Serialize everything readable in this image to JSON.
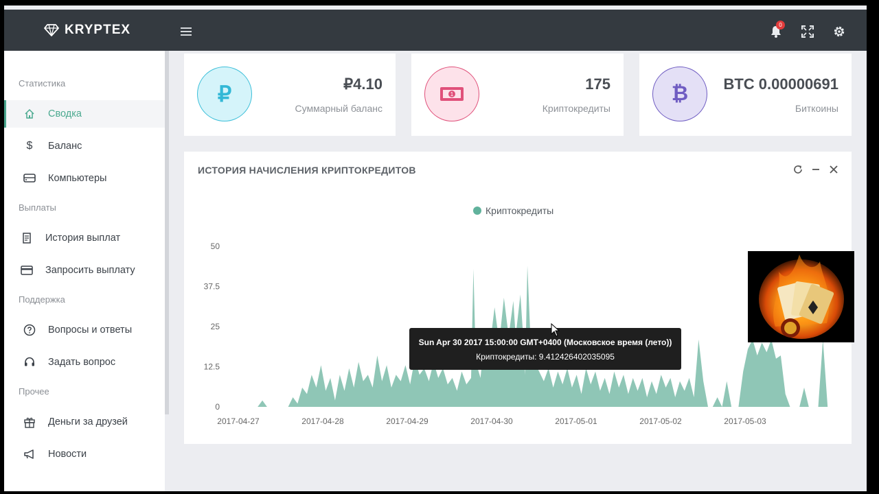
{
  "app": {
    "brand": "KRYPTEX",
    "notification_count": "0"
  },
  "sidebar": {
    "sections": [
      {
        "title": "Статистика",
        "items": [
          {
            "label": "Сводка",
            "icon": "home-icon",
            "active": true
          },
          {
            "label": "Баланс",
            "icon": "dollar-icon"
          },
          {
            "label": "Компьютеры",
            "icon": "computer-icon"
          }
        ]
      },
      {
        "title": "Выплаты",
        "items": [
          {
            "label": "История выплат",
            "icon": "document-icon"
          },
          {
            "label": "Запросить выплату",
            "icon": "credit-card-icon"
          }
        ]
      },
      {
        "title": "Поддержка",
        "items": [
          {
            "label": "Вопросы и ответы",
            "icon": "help-icon"
          },
          {
            "label": "Задать вопрос",
            "icon": "headset-icon"
          }
        ]
      },
      {
        "title": "Прочее",
        "items": [
          {
            "label": "Деньги за друзей",
            "icon": "gift-icon"
          },
          {
            "label": "Новости",
            "icon": "megaphone-icon"
          }
        ]
      }
    ]
  },
  "stats": [
    {
      "value": "₽4.10",
      "label": "Суммарный баланс",
      "icon": "ruble-icon",
      "color": "#3cbfd9"
    },
    {
      "value": "175",
      "label": "Криптокредиты",
      "icon": "banknote-icon",
      "color": "#e0507a"
    },
    {
      "value": "BTC 0.00000691",
      "label": "Биткоины",
      "icon": "bitcoin-icon",
      "color": "#6f5cc2"
    }
  ],
  "panel": {
    "title": "ИСТОРИЯ НАЧИСЛЕНИЯ КРИПТОКРЕДИТОВ"
  },
  "tooltip": {
    "title": "Sun Apr 30 2017 15:00:00 GMT+0400 (Московское время (лето))",
    "line": "Криптокредиты: 9.412426402035095"
  },
  "chart_data": {
    "type": "area",
    "series": [
      {
        "name": "Криптокредиты",
        "color": "#8fc6b6"
      }
    ],
    "x_tick_labels": [
      "2017-04-27",
      "2017-04-28",
      "2017-04-29",
      "2017-04-30",
      "2017-05-01",
      "2017-05-02",
      "2017-05-03"
    ],
    "y_tick_labels": [
      "0",
      "12.5",
      "25",
      "37.5",
      "50"
    ],
    "ylim": [
      0,
      50
    ],
    "legend_position": "top-center",
    "grid": false,
    "points": [
      [
        0,
        0
      ],
      [
        3.0,
        0
      ],
      [
        3.4,
        2
      ],
      [
        3.8,
        0
      ],
      [
        5.6,
        0
      ],
      [
        6.0,
        3
      ],
      [
        6.4,
        1
      ],
      [
        6.8,
        6
      ],
      [
        7.2,
        4
      ],
      [
        7.6,
        10
      ],
      [
        8.0,
        6
      ],
      [
        8.4,
        13
      ],
      [
        8.8,
        5
      ],
      [
        9.2,
        9
      ],
      [
        9.6,
        2
      ],
      [
        10.0,
        10
      ],
      [
        10.4,
        5
      ],
      [
        10.8,
        12
      ],
      [
        11.2,
        6
      ],
      [
        11.6,
        14
      ],
      [
        12.0,
        8
      ],
      [
        12.4,
        10
      ],
      [
        12.8,
        6
      ],
      [
        13.2,
        16
      ],
      [
        13.6,
        8
      ],
      [
        14.0,
        13
      ],
      [
        14.4,
        6
      ],
      [
        14.8,
        10
      ],
      [
        15.2,
        8
      ],
      [
        15.6,
        13
      ],
      [
        16.0,
        7
      ],
      [
        16.4,
        15
      ],
      [
        16.8,
        10
      ],
      [
        17.2,
        12
      ],
      [
        17.6,
        8
      ],
      [
        18.0,
        14
      ],
      [
        18.4,
        9
      ],
      [
        18.8,
        12
      ],
      [
        19.2,
        7
      ],
      [
        19.6,
        9
      ],
      [
        20.0,
        5
      ],
      [
        20.4,
        11
      ],
      [
        20.8,
        7
      ],
      [
        21.2,
        9
      ],
      [
        21.4,
        43
      ],
      [
        21.6,
        14
      ],
      [
        22.0,
        9
      ],
      [
        22.4,
        24
      ],
      [
        22.8,
        19
      ],
      [
        23.2,
        31
      ],
      [
        23.6,
        20
      ],
      [
        24.0,
        34
      ],
      [
        24.4,
        22
      ],
      [
        24.8,
        33
      ],
      [
        25.0,
        22
      ],
      [
        25.4,
        35
      ],
      [
        25.6,
        24
      ],
      [
        25.8,
        10
      ],
      [
        26.0,
        44
      ],
      [
        26.3,
        18
      ],
      [
        26.6,
        14
      ],
      [
        27.0,
        11
      ],
      [
        27.4,
        8
      ],
      [
        27.8,
        12
      ],
      [
        28.2,
        6
      ],
      [
        28.6,
        11
      ],
      [
        29.0,
        7
      ],
      [
        29.4,
        12
      ],
      [
        29.8,
        6
      ],
      [
        30.2,
        10
      ],
      [
        30.6,
        4
      ],
      [
        31.0,
        12
      ],
      [
        31.4,
        7
      ],
      [
        31.8,
        11
      ],
      [
        32.2,
        5
      ],
      [
        32.6,
        9
      ],
      [
        33.0,
        4
      ],
      [
        33.4,
        11
      ],
      [
        33.8,
        6
      ],
      [
        34.2,
        10
      ],
      [
        34.6,
        4
      ],
      [
        35.0,
        9
      ],
      [
        35.4,
        5
      ],
      [
        35.8,
        9
      ],
      [
        36.2,
        3
      ],
      [
        36.6,
        8
      ],
      [
        37.0,
        4
      ],
      [
        37.4,
        10
      ],
      [
        37.8,
        6
      ],
      [
        38.2,
        9
      ],
      [
        38.6,
        3
      ],
      [
        39.0,
        8
      ],
      [
        39.4,
        5
      ],
      [
        39.8,
        9
      ],
      [
        40.2,
        3
      ],
      [
        40.6,
        21
      ],
      [
        41.0,
        8
      ],
      [
        41.4,
        0
      ],
      [
        41.8,
        0
      ],
      [
        42.2,
        3
      ],
      [
        42.6,
        0
      ],
      [
        43.0,
        8
      ],
      [
        43.4,
        0
      ],
      [
        44.0,
        0
      ],
      [
        44.4,
        11
      ],
      [
        44.8,
        18
      ],
      [
        45.2,
        21
      ],
      [
        45.6,
        16
      ],
      [
        46.0,
        20
      ],
      [
        46.4,
        17
      ],
      [
        46.8,
        21
      ],
      [
        47.2,
        15
      ],
      [
        47.6,
        16
      ],
      [
        48.0,
        4
      ],
      [
        48.4,
        0
      ],
      [
        49.2,
        0
      ],
      [
        49.6,
        6
      ],
      [
        50.0,
        0
      ],
      [
        50.8,
        0
      ],
      [
        51.2,
        21
      ],
      [
        51.6,
        0
      ],
      [
        52.0,
        0
      ]
    ]
  },
  "icons": {
    "brand": "diamond-icon",
    "menu": "hamburger-icon",
    "bell": "bell-icon",
    "fullscreen": "fullscreen-icon",
    "settings": "gear-icon",
    "refresh": "refresh-icon",
    "minimize": "minimize-icon",
    "close": "close-icon"
  }
}
